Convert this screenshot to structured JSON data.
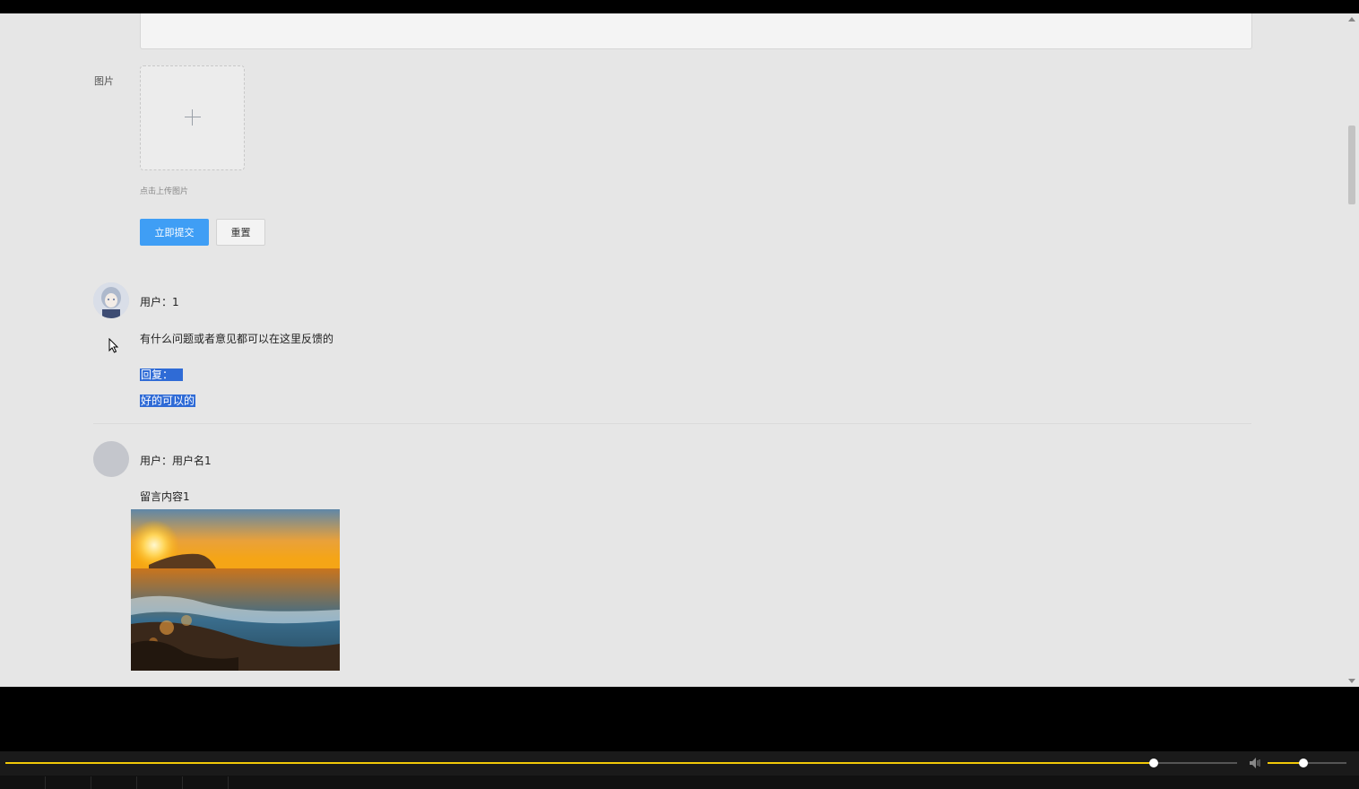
{
  "form": {
    "image_label": "图片",
    "upload_hint": "点击上传图片",
    "submit_label": "立即提交",
    "reset_label": "重置"
  },
  "comments": [
    {
      "user": "用户：1",
      "content": "有什么问题或者意见都可以在这里反馈的",
      "reply_label": "回复：",
      "reply_text": "好的可以的"
    },
    {
      "user": "用户：用户名1",
      "content": "留言内容1"
    }
  ],
  "player": {
    "progress": 0.932,
    "volume": 0.45
  },
  "colors": {
    "accent": "#3f9ef5",
    "selection": "#2f6bd6",
    "seek": "#f0c808"
  }
}
